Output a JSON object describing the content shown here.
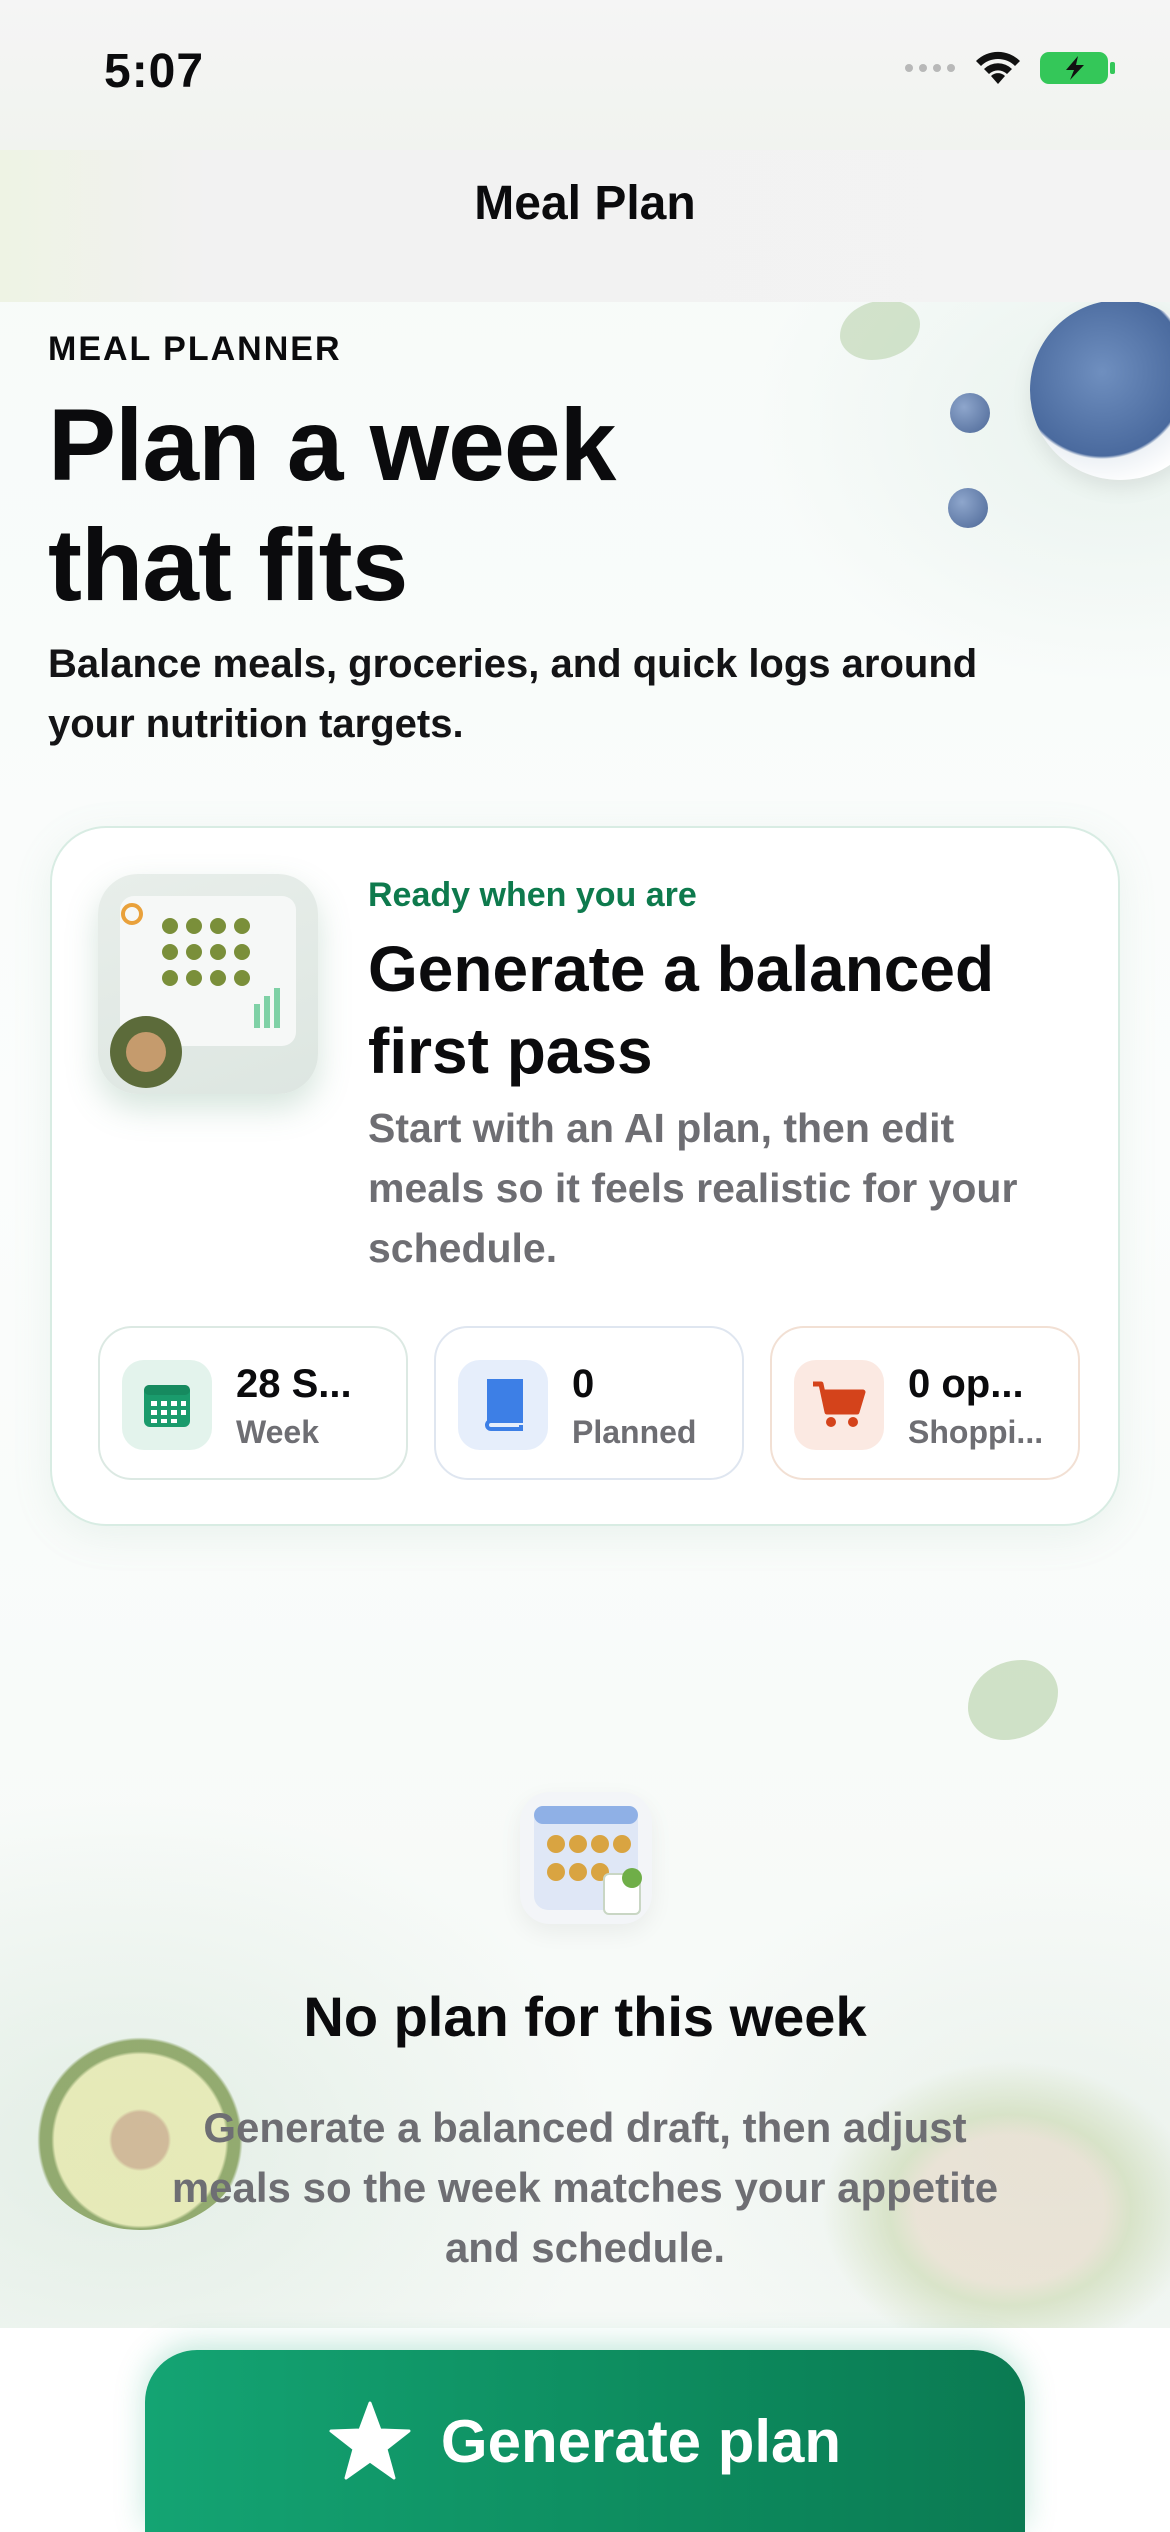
{
  "status_bar": {
    "time": "5:07"
  },
  "nav": {
    "title": "Meal Plan"
  },
  "hero": {
    "eyebrow": "MEAL PLANNER",
    "headline_line1": "Plan a week",
    "headline_line2": "that fits",
    "subhead": "Balance meals, groceries, and quick logs around your nutrition targets."
  },
  "card": {
    "eyebrow": "Ready when you are",
    "title": "Generate a balanced first pass",
    "text": "Start with an AI plan, then edit meals so it feels realistic for your schedule.",
    "chips": [
      {
        "value": "28 S...",
        "label": "Week",
        "icon": "calendar-icon",
        "color": "#1a9b6c",
        "bg": "#e3f3ec"
      },
      {
        "value": "0",
        "label": "Planned",
        "icon": "book-icon",
        "color": "#3d7fe6",
        "bg": "#e6eefb"
      },
      {
        "value": "0 op...",
        "label": "Shoppi...",
        "icon": "cart-icon",
        "color": "#d4431b",
        "bg": "#fbe9e2"
      }
    ]
  },
  "empty_state": {
    "title": "No plan for this week",
    "text": "Generate a balanced draft, then adjust meals so the week matches your appetite and schedule."
  },
  "cta": {
    "label": "Generate plan",
    "icon": "star-icon"
  },
  "colors": {
    "accent": "#0e7a4d",
    "cta_start": "#14a473",
    "cta_end": "#0b7a52"
  }
}
